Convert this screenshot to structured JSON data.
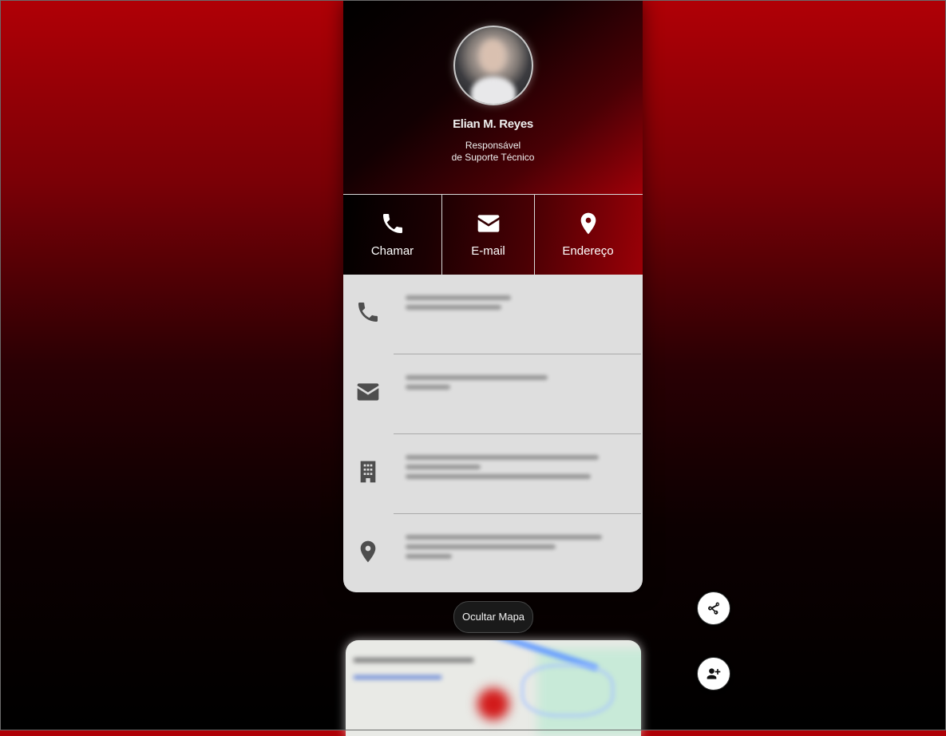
{
  "profile": {
    "name": "Elian M. Reyes",
    "role_line1": "Responsável",
    "role_line2": "de Suporte Técnico",
    "avatar_icon": "profile-photo"
  },
  "actions": [
    {
      "label": "Chamar",
      "icon": "phone-icon"
    },
    {
      "label": "E-mail",
      "icon": "envelope-icon"
    },
    {
      "label": "Endereço",
      "icon": "map-marker-icon"
    }
  ],
  "info_rows": [
    {
      "icon": "phone-icon",
      "lines": [
        "blurred",
        "blurred"
      ]
    },
    {
      "icon": "envelope-icon",
      "lines": [
        "blurred",
        "blurred"
      ]
    },
    {
      "icon": "building-icon",
      "lines": [
        "blurred",
        "blurred",
        "blurred"
      ]
    },
    {
      "icon": "map-marker-icon",
      "lines": [
        "blurred",
        "blurred",
        "blurred"
      ]
    }
  ],
  "map_toggle": {
    "label": "Ocultar Mapa"
  },
  "fabs": {
    "share_icon": "share-icon",
    "add_contact_icon": "add-contact-icon"
  },
  "colors": {
    "accent": "#a00008",
    "background_top": "#b00006",
    "background_bottom": "#000000",
    "panel": "#dedede"
  }
}
